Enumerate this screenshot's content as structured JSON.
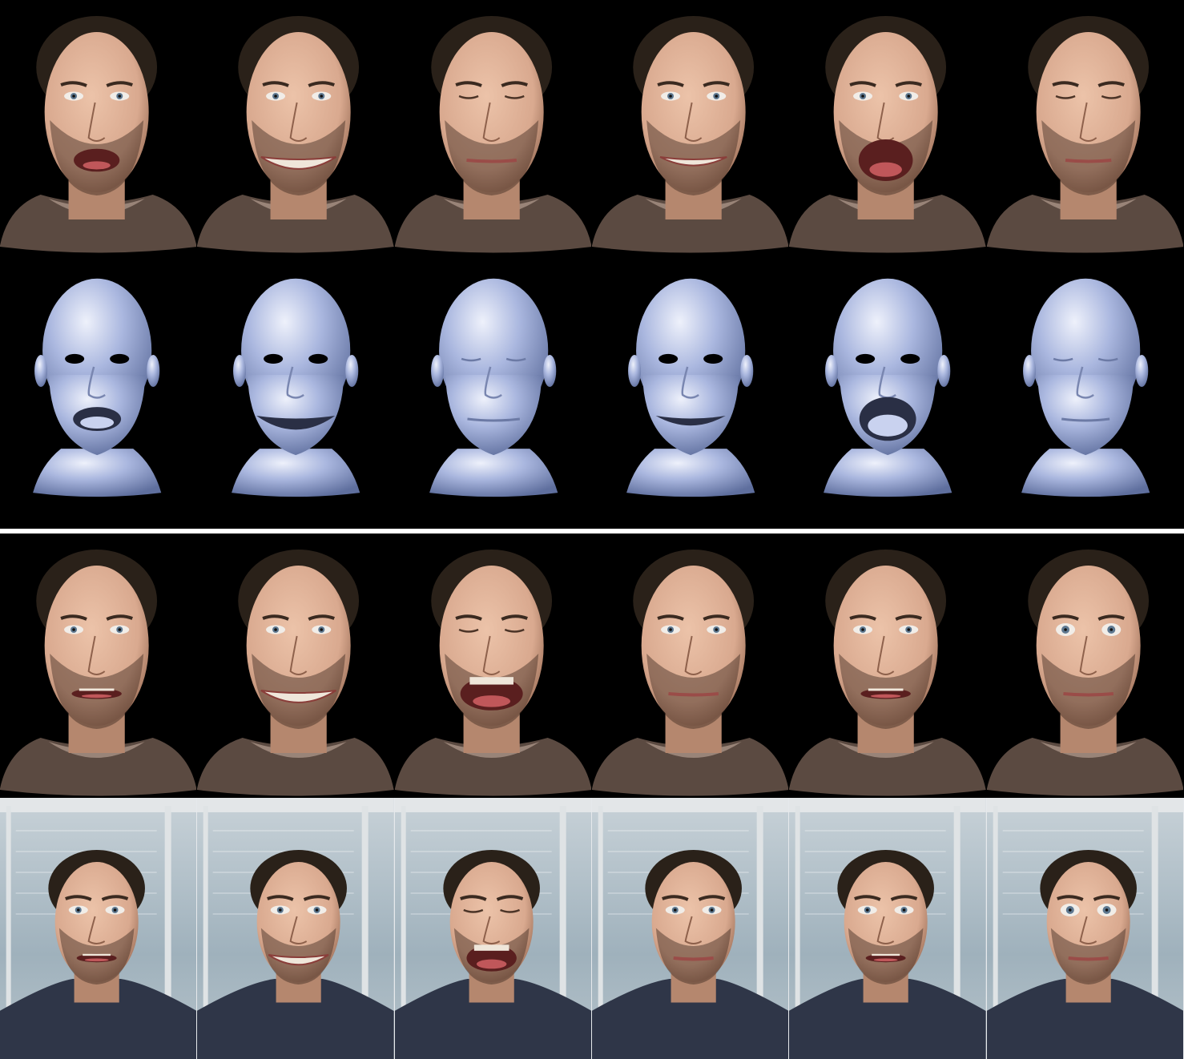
{
  "figure": {
    "colors": {
      "dark_background": "#000000",
      "separator": "#ffffff",
      "mesh_blue": "#aab7df",
      "skin": "#d9a98f",
      "hair": "#2a2119",
      "shirt_brown": "#5b4a41",
      "sweater": "#2f3648",
      "office_glass": "#9fb1bc"
    },
    "rows": [
      {
        "name": "avatar-rendering-row",
        "panels": [
          {
            "expression": "mouth-open-o"
          },
          {
            "expression": "wide-smile"
          },
          {
            "expression": "eyes-closed"
          },
          {
            "expression": "grimace"
          },
          {
            "expression": "open-yawn"
          },
          {
            "expression": "squint"
          }
        ]
      },
      {
        "name": "mesh-geometry-row",
        "panels": [
          {
            "expression": "mouth-open-o"
          },
          {
            "expression": "wide-smile"
          },
          {
            "expression": "eyes-closed"
          },
          {
            "expression": "grimace"
          },
          {
            "expression": "open-yawn"
          },
          {
            "expression": "squint"
          }
        ]
      },
      {
        "name": "reenacted-avatar-row",
        "panels": [
          {
            "expression": "neutral-talk"
          },
          {
            "expression": "grin"
          },
          {
            "expression": "laugh"
          },
          {
            "expression": "neutral"
          },
          {
            "expression": "talk"
          },
          {
            "expression": "neutral-eyes-wide"
          }
        ]
      },
      {
        "name": "driving-video-row",
        "panels": [
          {
            "expression": "neutral-talk"
          },
          {
            "expression": "grin"
          },
          {
            "expression": "laugh"
          },
          {
            "expression": "neutral"
          },
          {
            "expression": "talk"
          },
          {
            "expression": "neutral-eyes-wide"
          }
        ]
      }
    ]
  }
}
